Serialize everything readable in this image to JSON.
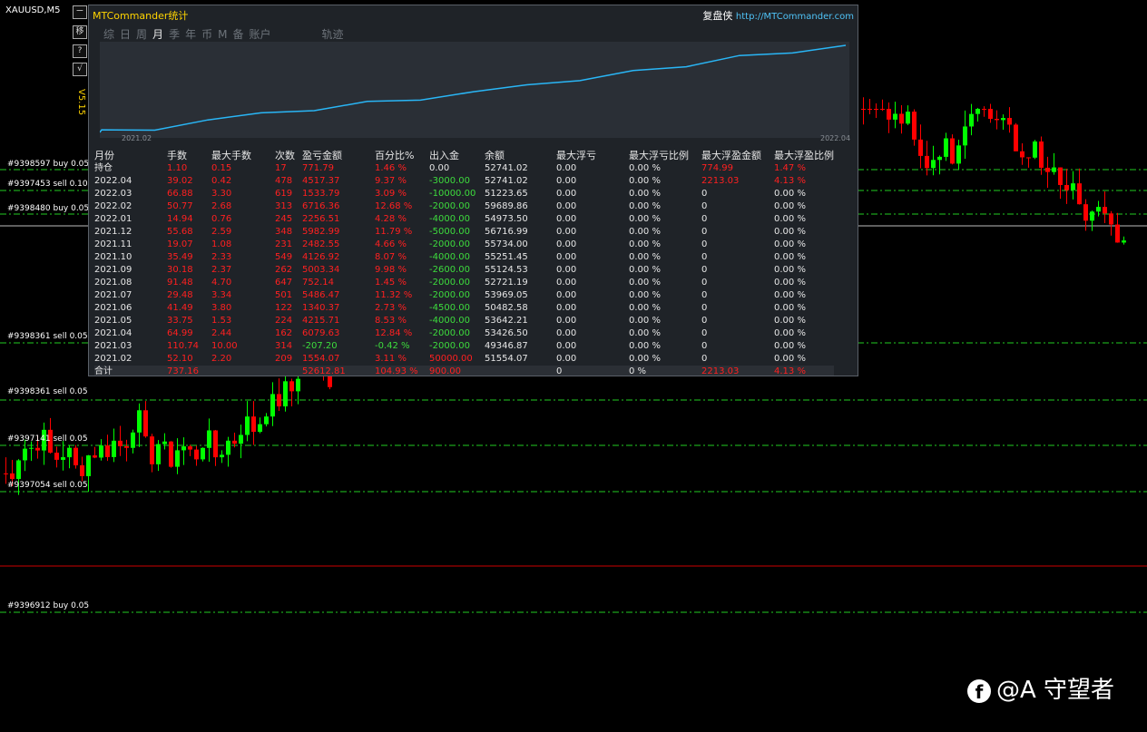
{
  "chart": {
    "symbol": "XAUUSD,M5",
    "colors": {
      "up": "#00ff00",
      "down": "#ff0000",
      "level": "#22cc22",
      "price_line": "#cc0000"
    },
    "side_buttons": [
      "ㄧ",
      "移",
      "?",
      "√"
    ],
    "version": "V5.15",
    "order_levels": [
      "#9398597 buy 0.05",
      "#9397453 sell 0.10",
      "#9398480 buy 0.05",
      "#9398361 sell 0.05",
      "#9398361 sell 0.05",
      "#9397141 sell 0.05",
      "#9397054 sell 0.05",
      "#9396912 buy 0.05"
    ]
  },
  "panel": {
    "title": "MTCommander统计",
    "brand": "复盘侠",
    "url": "http://MTCommander.com",
    "tabs": [
      "综",
      "日",
      "周",
      "月",
      "季",
      "年",
      "币",
      "M",
      "备",
      "账户",
      "轨迹"
    ],
    "active_tab": "月",
    "curve_start": "2021.02",
    "curve_end": "2022.04",
    "headers": [
      "月份",
      "手数",
      "最大手数",
      "次数",
      "盈亏金额",
      "百分比%",
      "出入金",
      "余额",
      "最大浮亏",
      "最大浮亏比例",
      "最大浮盈金额",
      "最大浮盈比例"
    ],
    "rows": [
      [
        "持仓",
        "1.10",
        "0.15",
        "17",
        "771.79",
        "1.46 %",
        "0.00",
        "52741.02",
        "0.00",
        "0.00 %",
        "774.99",
        "1.47 %"
      ],
      [
        "2022.04",
        "39.02",
        "0.42",
        "478",
        "4517.37",
        "9.37 %",
        "-3000.00",
        "52741.02",
        "0.00",
        "0.00 %",
        "2213.03",
        "4.13 %"
      ],
      [
        "2022.03",
        "66.88",
        "3.30",
        "619",
        "1533.79",
        "3.09 %",
        "-10000.00",
        "51223.65",
        "0.00",
        "0.00 %",
        "0",
        "0.00 %"
      ],
      [
        "2022.02",
        "50.77",
        "2.68",
        "313",
        "6716.36",
        "12.68 %",
        "-2000.00",
        "59689.86",
        "0.00",
        "0.00 %",
        "0",
        "0.00 %"
      ],
      [
        "2022.01",
        "14.94",
        "0.76",
        "245",
        "2256.51",
        "4.28 %",
        "-4000.00",
        "54973.50",
        "0.00",
        "0.00 %",
        "0",
        "0.00 %"
      ],
      [
        "2021.12",
        "55.68",
        "2.59",
        "348",
        "5982.99",
        "11.79 %",
        "-5000.00",
        "56716.99",
        "0.00",
        "0.00 %",
        "0",
        "0.00 %"
      ],
      [
        "2021.11",
        "19.07",
        "1.08",
        "231",
        "2482.55",
        "4.66 %",
        "-2000.00",
        "55734.00",
        "0.00",
        "0.00 %",
        "0",
        "0.00 %"
      ],
      [
        "2021.10",
        "35.49",
        "2.33",
        "549",
        "4126.92",
        "8.07 %",
        "-4000.00",
        "55251.45",
        "0.00",
        "0.00 %",
        "0",
        "0.00 %"
      ],
      [
        "2021.09",
        "30.18",
        "2.37",
        "262",
        "5003.34",
        "9.98 %",
        "-2600.00",
        "55124.53",
        "0.00",
        "0.00 %",
        "0",
        "0.00 %"
      ],
      [
        "2021.08",
        "91.48",
        "4.70",
        "647",
        "752.14",
        "1.45 %",
        "-2000.00",
        "52721.19",
        "0.00",
        "0.00 %",
        "0",
        "0.00 %"
      ],
      [
        "2021.07",
        "29.48",
        "3.34",
        "501",
        "5486.47",
        "11.32 %",
        "-2000.00",
        "53969.05",
        "0.00",
        "0.00 %",
        "0",
        "0.00 %"
      ],
      [
        "2021.06",
        "41.49",
        "3.80",
        "122",
        "1340.37",
        "2.73 %",
        "-4500.00",
        "50482.58",
        "0.00",
        "0.00 %",
        "0",
        "0.00 %"
      ],
      [
        "2021.05",
        "33.75",
        "1.53",
        "224",
        "4215.71",
        "8.53 %",
        "-4000.00",
        "53642.21",
        "0.00",
        "0.00 %",
        "0",
        "0.00 %"
      ],
      [
        "2021.04",
        "64.99",
        "2.44",
        "162",
        "6079.63",
        "12.84 %",
        "-2000.00",
        "53426.50",
        "0.00",
        "0.00 %",
        "0",
        "0.00 %"
      ],
      [
        "2021.03",
        "110.74",
        "10.00",
        "314",
        "-207.20",
        "-0.42 %",
        "-2000.00",
        "49346.87",
        "0.00",
        "0.00 %",
        "0",
        "0.00 %"
      ],
      [
        "2021.02",
        "52.10",
        "2.20",
        "209",
        "1554.07",
        "3.11 %",
        "50000.00",
        "51554.07",
        "0.00",
        "0.00 %",
        "0",
        "0.00 %"
      ]
    ],
    "total": [
      "合计",
      "737.16",
      "",
      "",
      "52612.81",
      "104.93 %",
      "900.00",
      "",
      "0",
      "0 %",
      "2213.03",
      "4.13 %"
    ]
  },
  "watermark": {
    "icon": "f",
    "text": "@A  守望者"
  }
}
